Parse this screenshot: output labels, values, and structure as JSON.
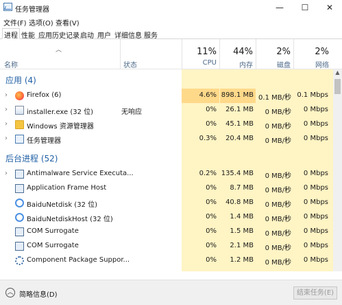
{
  "window": {
    "title": "任务管理器",
    "controls": {
      "minimize": "—",
      "maximize": "☐",
      "close": "✕"
    }
  },
  "menu": [
    "文件(F)",
    "选项(O)",
    "查看(V)"
  ],
  "tabs": [
    "进程",
    "性能",
    "应用历史记录",
    "启动",
    "用户",
    "详细信息",
    "服务"
  ],
  "active_tab": "进程",
  "columns": {
    "name": "名称",
    "status": "状态",
    "cpu": {
      "pct": "11%",
      "label": "CPU"
    },
    "memory": {
      "pct": "44%",
      "label": "内存"
    },
    "disk": {
      "pct": "2%",
      "label": "磁盘"
    },
    "network": {
      "pct": "2%",
      "label": "网络"
    }
  },
  "groups": {
    "apps": "应用 (4)",
    "background": "后台进程 (52)"
  },
  "apps": [
    {
      "name": "Firefox (6)",
      "icon": "firefox-icon",
      "status": "",
      "cpu": "4.6%",
      "memory": "898.1 MB",
      "disk": "0.1 MB/秒",
      "network": "0.1 Mbps"
    },
    {
      "name": "installer.exe (32 位)",
      "icon": "exe-icon",
      "status": "无响应",
      "cpu": "0%",
      "memory": "26.1 MB",
      "disk": "0 MB/秒",
      "network": "0 Mbps"
    },
    {
      "name": "Windows 资源管理器",
      "icon": "folder-icon",
      "status": "",
      "cpu": "0%",
      "memory": "45.1 MB",
      "disk": "0 MB/秒",
      "network": "0 Mbps"
    },
    {
      "name": "任务管理器",
      "icon": "task-manager-icon",
      "status": "",
      "cpu": "0.3%",
      "memory": "20.4 MB",
      "disk": "0 MB/秒",
      "network": "0 Mbps"
    }
  ],
  "background": [
    {
      "name": "Antimalware Service Executa...",
      "icon": "service-icon",
      "expandable": true,
      "cpu": "0.2%",
      "memory": "135.4 MB",
      "disk": "0 MB/秒",
      "network": "0 Mbps"
    },
    {
      "name": "Application Frame Host",
      "icon": "window-icon",
      "expandable": false,
      "cpu": "0%",
      "memory": "8.7 MB",
      "disk": "0 MB/秒",
      "network": "0 Mbps"
    },
    {
      "name": "BaiduNetdisk (32 位)",
      "icon": "baidu-netdisk-icon",
      "expandable": false,
      "cpu": "0%",
      "memory": "40.8 MB",
      "disk": "0 MB/秒",
      "network": "0 Mbps"
    },
    {
      "name": "BaiduNetdiskHost (32 位)",
      "icon": "baidu-netdisk-icon",
      "expandable": false,
      "cpu": "0%",
      "memory": "1.4 MB",
      "disk": "0 MB/秒",
      "network": "0 Mbps"
    },
    {
      "name": "COM Surrogate",
      "icon": "window-icon",
      "expandable": false,
      "cpu": "0%",
      "memory": "1.5 MB",
      "disk": "0 MB/秒",
      "network": "0 Mbps"
    },
    {
      "name": "COM Surrogate",
      "icon": "window-icon",
      "expandable": false,
      "cpu": "0%",
      "memory": "2.1 MB",
      "disk": "0 MB/秒",
      "network": "0 Mbps"
    },
    {
      "name": "Component Package Suppor...",
      "icon": "gear-icon",
      "expandable": false,
      "cpu": "0%",
      "memory": "1.2 MB",
      "disk": "0 MB/秒",
      "network": "0 Mbps"
    }
  ],
  "footer": {
    "fewer_details": "简略信息(D)",
    "end_task": "结束任务(E)"
  }
}
